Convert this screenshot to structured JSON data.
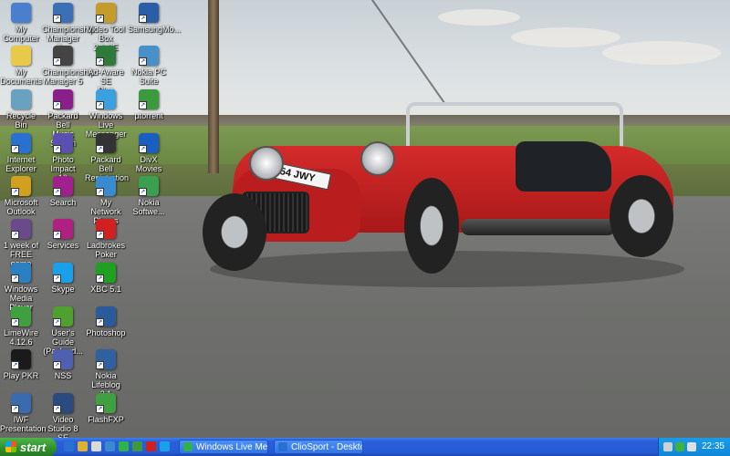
{
  "desktop": {
    "icons": [
      {
        "label": "My Computer",
        "icon": "computer-icon",
        "color": "#4a7fd0"
      },
      {
        "label": "Championship\nManager 0...",
        "icon": "cm-icon",
        "color": "#3b6fb6"
      },
      {
        "label": "Video Tool Box\n2.0 SE",
        "icon": "video-toolbox-icon",
        "color": "#c59b2a"
      },
      {
        "label": "SamsungMo...",
        "icon": "samsung-icon",
        "color": "#2a5fa8"
      },
      {
        "label": "My Documents",
        "icon": "folder-icon",
        "color": "#e8c94a"
      },
      {
        "label": "Championship\nManager 5",
        "icon": "cm5-icon",
        "color": "#444444"
      },
      {
        "label": "Ad-Aware SE\nPlus",
        "icon": "adaware-icon",
        "color": "#2e7a3a"
      },
      {
        "label": "Nokia PC Suite",
        "icon": "nokia-suite-icon",
        "color": "#4a90c8"
      },
      {
        "label": "Recycle Bin",
        "icon": "recycle-bin-icon",
        "color": "#6aa0c0"
      },
      {
        "label": "Packard Bell\nMusic Station",
        "icon": "music-station-icon",
        "color": "#8a1e8a"
      },
      {
        "label": "Windows Live\nMessenger",
        "icon": "messenger-icon",
        "color": "#3aa0e0"
      },
      {
        "label": "µtorrent",
        "icon": "utorrent-icon",
        "color": "#3c9a3c"
      },
      {
        "label": "Internet\nExplorer",
        "icon": "ie-icon",
        "color": "#2a70d0"
      },
      {
        "label": "Photo Impact\n10",
        "icon": "photoimpact-icon",
        "color": "#5a50b0"
      },
      {
        "label": "Packard Bell\nRegistration",
        "icon": "registration-icon",
        "color": "#333333"
      },
      {
        "label": "DivX Movies",
        "icon": "divx-icon",
        "color": "#1a5fc0"
      },
      {
        "label": "Microsoft\nOutlook",
        "icon": "outlook-icon",
        "color": "#d0a020"
      },
      {
        "label": "Search",
        "icon": "search-icon",
        "color": "#a02090"
      },
      {
        "label": "My Network\nPlaces",
        "icon": "network-icon",
        "color": "#3a8ad0"
      },
      {
        "label": "Nokia\nSoftwe...",
        "icon": "nokia-software-icon",
        "color": "#3aa050"
      },
      {
        "label": "1 week of\nFREE game",
        "icon": "free-game-icon",
        "color": "#6a4a8a"
      },
      {
        "label": "Services",
        "icon": "services-icon",
        "color": "#b02080"
      },
      {
        "label": "Ladbrokes\nPoker",
        "icon": "ladbrokes-icon",
        "color": "#d02020"
      },
      {
        "label": "Windows\nMedia Player",
        "icon": "media-player-icon",
        "color": "#2a80c0"
      },
      {
        "label": "Skype",
        "icon": "skype-icon",
        "color": "#1aa0e8"
      },
      {
        "label": "XBC 5.1",
        "icon": "xbc-icon",
        "color": "#20a020"
      },
      {
        "label": "LimeWire\n4.12.6",
        "icon": "limewire-icon",
        "color": "#40a040"
      },
      {
        "label": "User's Guide\n(Packard...",
        "icon": "users-guide-icon",
        "color": "#50a030"
      },
      {
        "label": "Photoshop",
        "icon": "photoshop-icon",
        "color": "#2a5a9a"
      },
      {
        "label": "Play PKR",
        "icon": "pkr-icon",
        "color": "#1a1a1a"
      },
      {
        "label": "NSS",
        "icon": "nss-icon",
        "color": "#5060b0"
      },
      {
        "label": "Nokia Lifeblog\n2.1",
        "icon": "lifeblog-icon",
        "color": "#3060a0"
      },
      {
        "label": "IWF\nPresentation",
        "icon": "iwf-icon",
        "color": "#3a6ab0"
      },
      {
        "label": "Video Studio 8\nSE",
        "icon": "video-studio-icon",
        "color": "#2a4a80"
      },
      {
        "label": "FlashFXP",
        "icon": "flashfxp-icon",
        "color": "#40a040"
      }
    ]
  },
  "car": {
    "plate": "54 JWY"
  },
  "taskbar": {
    "start_label": "start",
    "tasks": [
      {
        "label": "Windows Live Messen...",
        "icon": "messenger-task-icon",
        "color": "#2fb24a"
      },
      {
        "label": "ClioSport - Desktop B...",
        "icon": "browser-task-icon",
        "color": "#2a70d0"
      }
    ],
    "quick_launch": [
      {
        "icon": "ie-quicklaunch-icon",
        "color": "#2a70d0"
      },
      {
        "icon": "outlook-quicklaunch-icon",
        "color": "#e0b030"
      },
      {
        "icon": "desktop-quicklaunch-icon",
        "color": "#d9d9d9"
      },
      {
        "icon": "media-quicklaunch-icon",
        "color": "#3a8ad0"
      },
      {
        "icon": "messenger-quicklaunch-icon",
        "color": "#2fb24a"
      },
      {
        "icon": "utorrent-quicklaunch-icon",
        "color": "#3c9a3c"
      },
      {
        "icon": "opera-quicklaunch-icon",
        "color": "#d02020"
      },
      {
        "icon": "skype-quicklaunch-icon",
        "color": "#1aa0e8"
      }
    ],
    "clock": "22:35"
  }
}
